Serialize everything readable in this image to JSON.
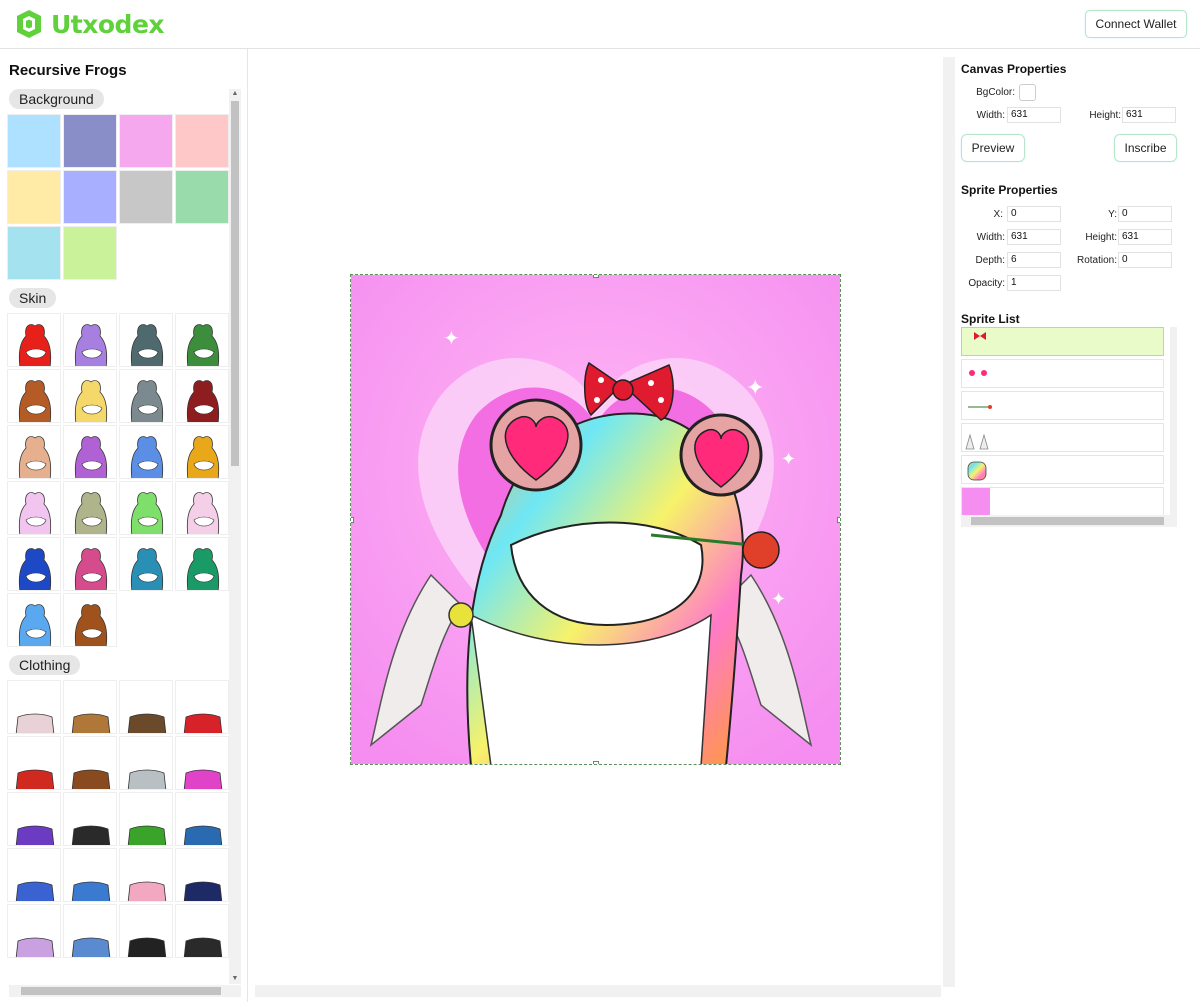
{
  "app": {
    "brand": "Utxodex",
    "connect_wallet": "Connect Wallet",
    "brand_color": "#5fd13b"
  },
  "left_panel": {
    "title": "Recursive Frogs",
    "sections": [
      {
        "label": "Background",
        "tiles": [
          "#aee0ff",
          "#8a8ec8",
          "#f6a8ef",
          "#ffc8c8",
          "#ffeaa6",
          "#a9afff",
          "#c7c7c7",
          "#99dbaa",
          "#a4e2f0",
          "#caf29a"
        ]
      },
      {
        "label": "Skin",
        "tiles": [
          "#e8201a",
          "#a77fe0",
          "#4f6a6f",
          "#3c8d3c",
          "#b45b26",
          "#f5d86a",
          "#7a8a8f",
          "#8e1d20",
          "#e6b08f",
          "#b062d4",
          "#5b8fe6",
          "#e8a81a",
          "#f2c4f0",
          "#b0b48a",
          "#7ee06a",
          "#f5cfe8",
          "#1e49c6",
          "#d64b8c",
          "#2a8fb5",
          "#1a9a66",
          "#5aa8f0",
          "#a0521d"
        ]
      },
      {
        "label": "Clothing",
        "tiles": [
          "#e9d2d6",
          "#b07838",
          "#6a4a2a",
          "#d8222a",
          "#d02a20",
          "#8a4a20",
          "#b8c0c4",
          "#e043c8",
          "#6b3cc2",
          "#2a2a2a",
          "#3aa32a",
          "#2a6ab0",
          "#3a62d0",
          "#3a7ad0",
          "#f2a8c0",
          "#1e2a66",
          "#c9a0e0",
          "#5a8ad0",
          "#222222",
          "#2a2a2a"
        ]
      }
    ]
  },
  "canvas_properties": {
    "title": "Canvas Properties",
    "bgcolor_label": "BgColor:",
    "width_label": "Width:",
    "width": "631",
    "height_label": "Height:",
    "height": "631",
    "preview": "Preview",
    "inscribe": "Inscribe"
  },
  "sprite_properties": {
    "title": "Sprite Properties",
    "x_label": "X:",
    "x": "0",
    "y_label": "Y:",
    "y": "0",
    "width_label": "Width:",
    "width": "631",
    "height_label": "Height:",
    "height": "631",
    "depth_label": "Depth:",
    "depth": "6",
    "rotation_label": "Rotation:",
    "rotation": "0",
    "opacity_label": "Opacity:",
    "opacity": "1"
  },
  "sprite_list": {
    "title": "Sprite List",
    "items": [
      "bow sprite",
      "eyes sprite",
      "rose sprite",
      "wings sprite",
      "frog sprite",
      "heart background sprite"
    ]
  }
}
